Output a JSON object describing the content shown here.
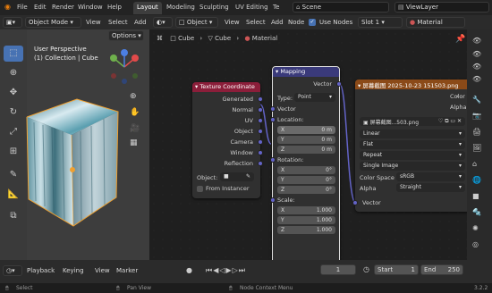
{
  "topbar": {
    "menus": [
      "File",
      "Edit",
      "Render",
      "Window",
      "Help"
    ],
    "tabs": [
      "Layout",
      "Modeling",
      "Sculpting",
      "UV Editing",
      "Te"
    ],
    "active_tab": "Layout",
    "scene": "Scene",
    "view_layer": "ViewLayer"
  },
  "viewport_header": {
    "mode": "Object Mode",
    "menus": [
      "View",
      "Select",
      "Add"
    ],
    "options": "Options"
  },
  "viewport": {
    "perspective": "User Perspective",
    "collection": "(1) Collection | Cube"
  },
  "node_header": {
    "type": "Object",
    "menus": [
      "View",
      "Select",
      "Add",
      "Node"
    ],
    "use_nodes": "Use Nodes",
    "slot": "Slot 1",
    "material": "Material"
  },
  "breadcrumb": [
    "Cube",
    "Cube",
    "Material"
  ],
  "texcoord_node": {
    "title": "Texture Coordinate",
    "outputs": [
      "Generated",
      "Normal",
      "UV",
      "Object",
      "Camera",
      "Window",
      "Reflection"
    ],
    "object_label": "Object:",
    "from_instancer": "From Instancer"
  },
  "mapping_node": {
    "title": "Mapping",
    "output": "Vector",
    "type_label": "Type:",
    "type_value": "Point",
    "vector_input": "Vector",
    "location_label": "Location:",
    "location": [
      {
        "axis": "X",
        "value": "0 m"
      },
      {
        "axis": "Y",
        "value": "0 m"
      },
      {
        "axis": "Z",
        "value": "0 m"
      }
    ],
    "rotation_label": "Rotation:",
    "rotation": [
      {
        "axis": "X",
        "value": "0°"
      },
      {
        "axis": "Y",
        "value": "0°"
      },
      {
        "axis": "Z",
        "value": "0°"
      }
    ],
    "scale_label": "Scale:",
    "scale": [
      {
        "axis": "X",
        "value": "1.000"
      },
      {
        "axis": "Y",
        "value": "1.000"
      },
      {
        "axis": "Z",
        "value": "1.000"
      }
    ]
  },
  "image_node": {
    "title": "屏幕截图 2025-10-23 151503.png",
    "outputs": [
      "Color",
      "Alpha"
    ],
    "image_name": "屏幕截图...503.png",
    "interpolation": "Linear",
    "projection": "Flat",
    "extension": "Repeat",
    "source": "Single Image",
    "color_space_label": "Color Space",
    "color_space": "sRGB",
    "alpha_label": "Alpha",
    "alpha": "Straight",
    "vector_input": "Vector"
  },
  "timeline": {
    "menus": [
      "Playback",
      "Keying",
      "View",
      "Marker"
    ],
    "current_frame": "1",
    "start_label": "Start",
    "start": "1",
    "end_label": "End",
    "end": "250"
  },
  "statusbar": {
    "items": [
      "Select",
      "Pan View",
      "Node Context Menu"
    ],
    "version": "3.2.2"
  },
  "colors": {
    "texcoord_header": "#8b1e3a",
    "mapping_header": "#3a3a7a",
    "image_header": "#8b4a18",
    "socket_vector": "#6363c7",
    "socket_color": "#c7b539",
    "accent": "#4772b3"
  }
}
